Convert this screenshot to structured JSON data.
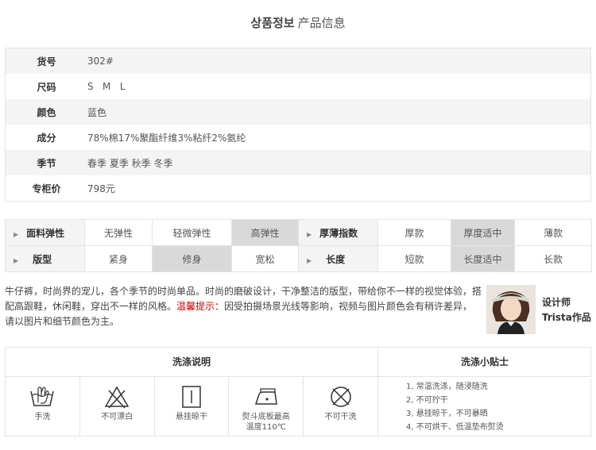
{
  "header": {
    "title_ko": "상품정보",
    "title_cn": "产品信息"
  },
  "info": [
    {
      "key": "货号",
      "value": "302#"
    },
    {
      "key": "尺码",
      "value": "S   M   L"
    },
    {
      "key": "颜色",
      "value": "蓝色"
    },
    {
      "key": "成分",
      "value": "78%棉17%聚酯纤维3%粘纤2%氨纶"
    },
    {
      "key": "季节",
      "value": "春季 夏季 秋季 冬季"
    },
    {
      "key": "专柜价",
      "value": "798元"
    }
  ],
  "attrs": {
    "row1": {
      "label_a": "面料弹性",
      "a": [
        "无弹性",
        "轻微弹性",
        "高弹性"
      ],
      "sel_a": 2,
      "label_b": "厚薄指数",
      "b": [
        "厚款",
        "厚度适中",
        "薄款"
      ],
      "sel_b": 1
    },
    "row2": {
      "label_a": "版型",
      "a": [
        "紧身",
        "修身",
        "宽松"
      ],
      "sel_a": 1,
      "label_b": "长度",
      "b": [
        "短款",
        "长度适中",
        "长款"
      ],
      "sel_b": 1
    }
  },
  "description": {
    "text": "牛仔裤，时尚界的宠儿，各个季节的时尚单品。时尚的磨破设计，干净整洁的版型，带给你不一样的视觉体验，搭配高跟鞋，休闲鞋，穿出不一样的风格。",
    "warn_label": "温馨提示：",
    "warn_text": "因受拍摄场景光线等影响，视频与图片颜色会有稍许差异，请以图片和细节颜色为主。"
  },
  "designer": {
    "line1": "设计师",
    "line2": "Trista作品"
  },
  "wash": {
    "title": "洗涤说明",
    "tips_title": "洗涤小贴士",
    "icons": [
      {
        "icon": "hand-wash-icon",
        "label": "手洗"
      },
      {
        "icon": "no-bleach-icon",
        "label": "不可漂白"
      },
      {
        "icon": "hang-dry-icon",
        "label": "悬挂晾干"
      },
      {
        "icon": "iron-110-icon",
        "label": "熨斗底板最高\n温度110℃"
      },
      {
        "icon": "no-dry-clean-icon",
        "label": "不可干洗"
      }
    ],
    "tips": [
      "1, 常温洗涤，随浸随洗",
      "2, 不可拧干",
      "3, 悬挂晾干，不可暴晒",
      "4, 不可烘干、低温垫布熨烫"
    ]
  }
}
